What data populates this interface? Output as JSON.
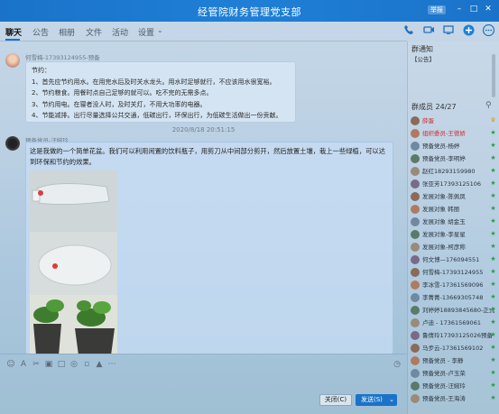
{
  "window": {
    "title": "经管院财务管理党支部",
    "badge": "举报",
    "controls": [
      "minimize",
      "maximize",
      "close"
    ]
  },
  "tabs": [
    {
      "label": "聊天",
      "active": true
    },
    {
      "label": "公告"
    },
    {
      "label": "相册"
    },
    {
      "label": "文件"
    },
    {
      "label": "活动"
    },
    {
      "label": "设置"
    }
  ],
  "toolbar_icons": [
    "phone-icon",
    "video-icon",
    "screen-share-icon",
    "add-icon",
    "more-icon"
  ],
  "messages": [
    {
      "sender": "何雪梅-17393124955-预备",
      "lines": [
        "节约：",
        "1、首先应节约用水。在用完水后及时关水龙头。用水时足够就行，不应该用水很宽裕。",
        "2、节约粮食。用餐时点自己足够的就可以。吃不完的无需多点。",
        "3、节约用电。在寝者没人时，及时关灯，不用大功率的电器。",
        "4、节能减排。出行尽量选择公共交通，低碳出行，环保出行，为低碳生活做出一份贡献。"
      ]
    },
    {
      "timestamp": "2020/8/18 20:51:15",
      "sender": "预备党员-汪婉玲",
      "text": "这是我做的一个简单花盆。我们可以利用闲置的饮料瓶子，用剪刀从中间部分剪开，然后放置土壤，栽上一些绿植，可以达到环保和节约的效果。"
    }
  ],
  "input": {
    "icons": [
      "emoji-icon",
      "font-icon",
      "screenshot-icon",
      "image-icon",
      "folder-icon",
      "mic-icon",
      "gift-icon",
      "shake-icon",
      "more-icon"
    ],
    "history_icon": "history-icon",
    "close_label": "关闭(C)",
    "send_label": "发送(S)"
  },
  "sidebar": {
    "notice_title": "群通知",
    "notice_text": "【公告】",
    "members_title": "群成员 24/27",
    "members": [
      {
        "name": "薛蛋",
        "color": "#d03030",
        "badge": "crown"
      },
      {
        "name": "组织委员-王德娇",
        "color": "#d03030",
        "badge": "star"
      },
      {
        "name": "预备党员-杨婷",
        "color": "#2b3640",
        "badge": "star"
      },
      {
        "name": "预备党员-李明婷",
        "color": "#2b3640",
        "badge": "star"
      },
      {
        "name": "赵红18293159980",
        "color": "#2b3640",
        "badge": "star"
      },
      {
        "name": "张亚芳17393125106",
        "color": "#2b3640",
        "badge": "star"
      },
      {
        "name": "发展对象-陈佩凤",
        "color": "#2b3640",
        "badge": "star"
      },
      {
        "name": "发展对象 韩丽",
        "color": "#2b3640",
        "badge": "star"
      },
      {
        "name": "发展对象 胡金玉",
        "color": "#2b3640",
        "badge": "star"
      },
      {
        "name": "发展对象-李星星",
        "color": "#2b3640",
        "badge": "star"
      },
      {
        "name": "发展对象-柯彦称",
        "color": "#2b3640",
        "badge": "star"
      },
      {
        "name": "何文博—176094551",
        "color": "#2b3640",
        "badge": "star"
      },
      {
        "name": "何雪梅-17393124955",
        "color": "#2b3640",
        "badge": "star"
      },
      {
        "name": "李冰雪-17361569096",
        "color": "#2b3640",
        "badge": "star"
      },
      {
        "name": "李菁菁-13669305748",
        "color": "#2b3640",
        "badge": "star"
      },
      {
        "name": "刘婷婷18893845680-正式",
        "color": "#2b3640",
        "badge": "star"
      },
      {
        "name": "卢迪 - 17361569061",
        "color": "#2b3640",
        "badge": "star"
      },
      {
        "name": "鲁倩玲17393125026预备",
        "color": "#2b3640",
        "badge": "star"
      },
      {
        "name": "马步云-17361569102",
        "color": "#2b3640",
        "badge": "star"
      },
      {
        "name": "预备党员 - 李静",
        "color": "#2b3640",
        "badge": "star"
      },
      {
        "name": "预备党员-卢玉荣",
        "color": "#2b3640",
        "badge": "star"
      },
      {
        "name": "预备党员-汪婉玲",
        "color": "#2b3640",
        "badge": "star"
      },
      {
        "name": "预备党员-王海涛",
        "color": "#2b3640",
        "badge": "star"
      }
    ]
  },
  "colors": {
    "titlebar": "#1a73c9",
    "accent": "#1a73c9",
    "admin_name": "#d03030"
  }
}
